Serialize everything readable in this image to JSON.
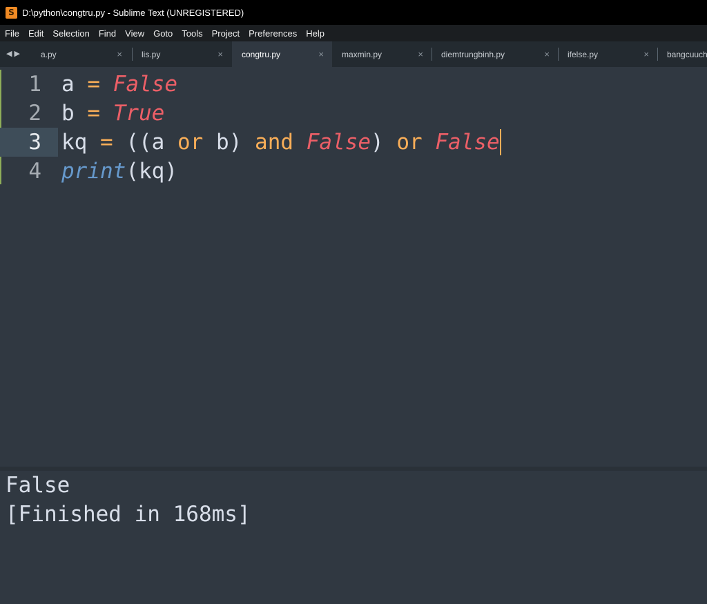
{
  "window": {
    "title": "D:\\python\\congtru.py - Sublime Text (UNREGISTERED)",
    "icon": "sublime-logo-icon",
    "icon_glyph": "S"
  },
  "menu": [
    "File",
    "Edit",
    "Selection",
    "Find",
    "View",
    "Goto",
    "Tools",
    "Project",
    "Preferences",
    "Help"
  ],
  "tabs": {
    "nav_glyphs": "◀▶",
    "close_glyph": "×",
    "items": [
      {
        "label": "a.py",
        "active": false
      },
      {
        "label": "lis.py",
        "active": false
      },
      {
        "label": "congtru.py",
        "active": true
      },
      {
        "label": "maxmin.py",
        "active": false
      },
      {
        "label": "diemtrungbinh.py",
        "active": false
      },
      {
        "label": "ifelse.py",
        "active": false
      },
      {
        "label": "bangcuuch",
        "active": false
      }
    ]
  },
  "editor": {
    "current_line": 3,
    "lines": [
      {
        "number": "1",
        "tokens": [
          {
            "t": "a",
            "k": "id"
          },
          {
            "t": " "
          },
          {
            "t": "=",
            "k": "op"
          },
          {
            "t": " "
          },
          {
            "t": "False",
            "k": "const"
          }
        ]
      },
      {
        "number": "2",
        "tokens": [
          {
            "t": "b",
            "k": "id"
          },
          {
            "t": " "
          },
          {
            "t": "=",
            "k": "op"
          },
          {
            "t": " "
          },
          {
            "t": "True",
            "k": "const"
          }
        ]
      },
      {
        "number": "3",
        "tokens": [
          {
            "t": "kq",
            "k": "id"
          },
          {
            "t": " "
          },
          {
            "t": "=",
            "k": "op"
          },
          {
            "t": " "
          },
          {
            "t": "((",
            "k": "punc"
          },
          {
            "t": "a",
            "k": "id"
          },
          {
            "t": " "
          },
          {
            "t": "or",
            "k": "kw"
          },
          {
            "t": " "
          },
          {
            "t": "b",
            "k": "id"
          },
          {
            "t": ")",
            "k": "punc"
          },
          {
            "t": " "
          },
          {
            "t": "and",
            "k": "kw"
          },
          {
            "t": " "
          },
          {
            "t": "False",
            "k": "const"
          },
          {
            "t": ")",
            "k": "punc"
          },
          {
            "t": " "
          },
          {
            "t": "or",
            "k": "kw"
          },
          {
            "t": " "
          },
          {
            "t": "False",
            "k": "const"
          }
        ]
      },
      {
        "number": "4",
        "tokens": [
          {
            "t": "print",
            "k": "fn"
          },
          {
            "t": "(",
            "k": "punc"
          },
          {
            "t": "kq",
            "k": "id"
          },
          {
            "t": ")",
            "k": "punc"
          }
        ]
      }
    ]
  },
  "output": {
    "lines": [
      "False",
      "[Finished in 168ms]"
    ]
  },
  "colors": {
    "background": "#303841",
    "keyword": "#f9ae58",
    "constant": "#ec5f67",
    "function": "#6699cc",
    "text": "#d8dee9"
  }
}
